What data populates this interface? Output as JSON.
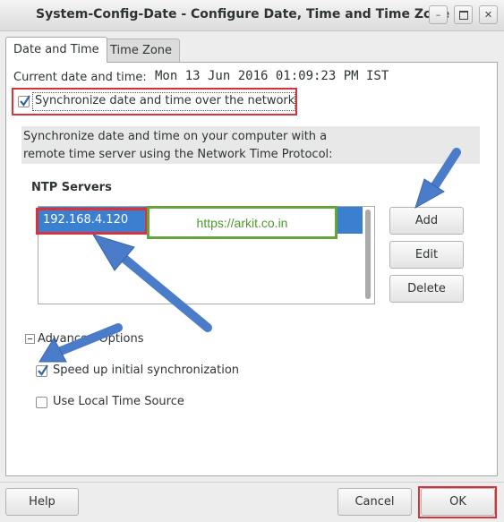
{
  "window": {
    "title": "System-Config-Date - Configure Date, Time and Time Zone",
    "buttons": [
      "minimize",
      "maximize",
      "close"
    ]
  },
  "tabs": [
    {
      "label": "Date and Time",
      "selected": true
    },
    {
      "label": "Time Zone",
      "selected": false
    }
  ],
  "current": {
    "label": "Current date and time:",
    "value": "Mon 13 Jun 2016 01:09:23 PM IST"
  },
  "sync": {
    "label": "Synchronize date and time over the network",
    "checked": true
  },
  "info": {
    "line1": "Synchronize date and time on your computer with a",
    "line2": "remote time server using the Network Time Protocol:"
  },
  "ntp": {
    "heading": "NTP Servers",
    "servers": [
      "192.168.4.120"
    ],
    "selected_index": 0
  },
  "side_buttons": {
    "add": "Add",
    "edit": "Edit",
    "delete": "Delete"
  },
  "watermark": "https://arkit.co.in",
  "advanced": {
    "label": "Advanced Options",
    "expanded": true,
    "speed_up": {
      "label": "Speed up initial synchronization",
      "checked": true
    },
    "local_source": {
      "label": "Use Local Time Source",
      "checked": false
    }
  },
  "footer": {
    "help": "Help",
    "cancel": "Cancel",
    "ok": "OK"
  },
  "colors": {
    "highlight_red": "#d9333a",
    "selection_blue": "#3b7fd0",
    "watermark_green": "#65a33b",
    "arrow_blue": "#4a7cc9"
  }
}
